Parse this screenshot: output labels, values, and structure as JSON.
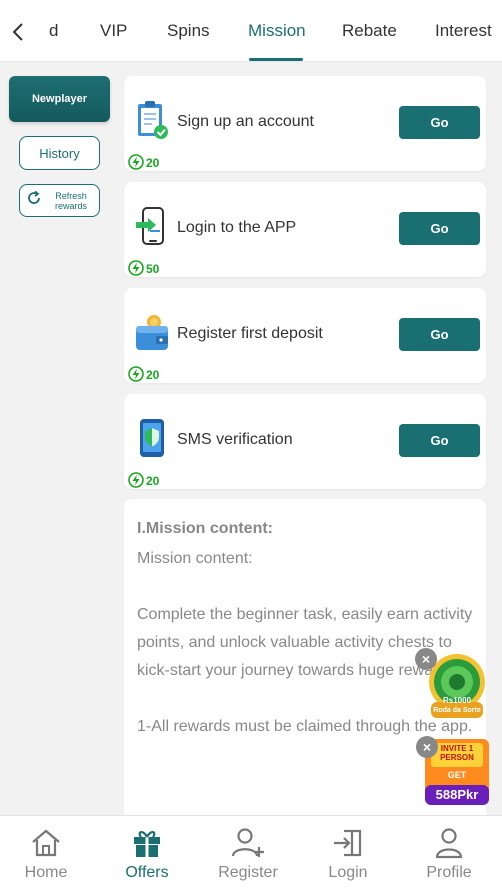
{
  "tabs": [
    {
      "label": "d"
    },
    {
      "label": "VIP"
    },
    {
      "label": "Spins"
    },
    {
      "label": "Mission"
    },
    {
      "label": "Rebate"
    },
    {
      "label": "Interest"
    }
  ],
  "active_tab": "Mission",
  "sidebar": {
    "newplayer": "Newplayer",
    "history": "History",
    "refresh": "Refresh rewards"
  },
  "missions": [
    {
      "title": "Sign up an account",
      "button": "Go",
      "points": "20",
      "icon": "clipboard-check-icon"
    },
    {
      "title": "Login to the APP",
      "button": "Go",
      "points": "50",
      "icon": "phone-login-icon"
    },
    {
      "title": "Register first deposit",
      "button": "Go",
      "points": "20",
      "icon": "wallet-coin-icon"
    },
    {
      "title": "SMS verification",
      "button": "Go",
      "points": "20",
      "icon": "phone-shield-icon"
    }
  ],
  "content": {
    "heading": "I.Mission content:",
    "subheading": "Mission content:",
    "paragraph1": "Complete the beginner task, easily earn activity points, and unlock valuable activity chests to kick-start your journey towards huge rewards!",
    "paragraph2": "1-All rewards must be claimed through the app."
  },
  "promos": {
    "wheel_amount": "Rs1000",
    "wheel_label": "Roda da Sorte",
    "invite_line1": "INVITE 1",
    "invite_line2": "PERSON",
    "invite_get": "GET",
    "invite_amount": "588Pkr"
  },
  "bottom_nav": [
    {
      "label": "Home",
      "icon": "home-icon"
    },
    {
      "label": "Offers",
      "icon": "gift-icon"
    },
    {
      "label": "Register",
      "icon": "user-plus-icon"
    },
    {
      "label": "Login",
      "icon": "login-icon"
    },
    {
      "label": "Profile",
      "icon": "profile-icon"
    }
  ],
  "colors": {
    "accent": "#1a6f72",
    "points": "#1aa61f",
    "muted": "#888888"
  }
}
